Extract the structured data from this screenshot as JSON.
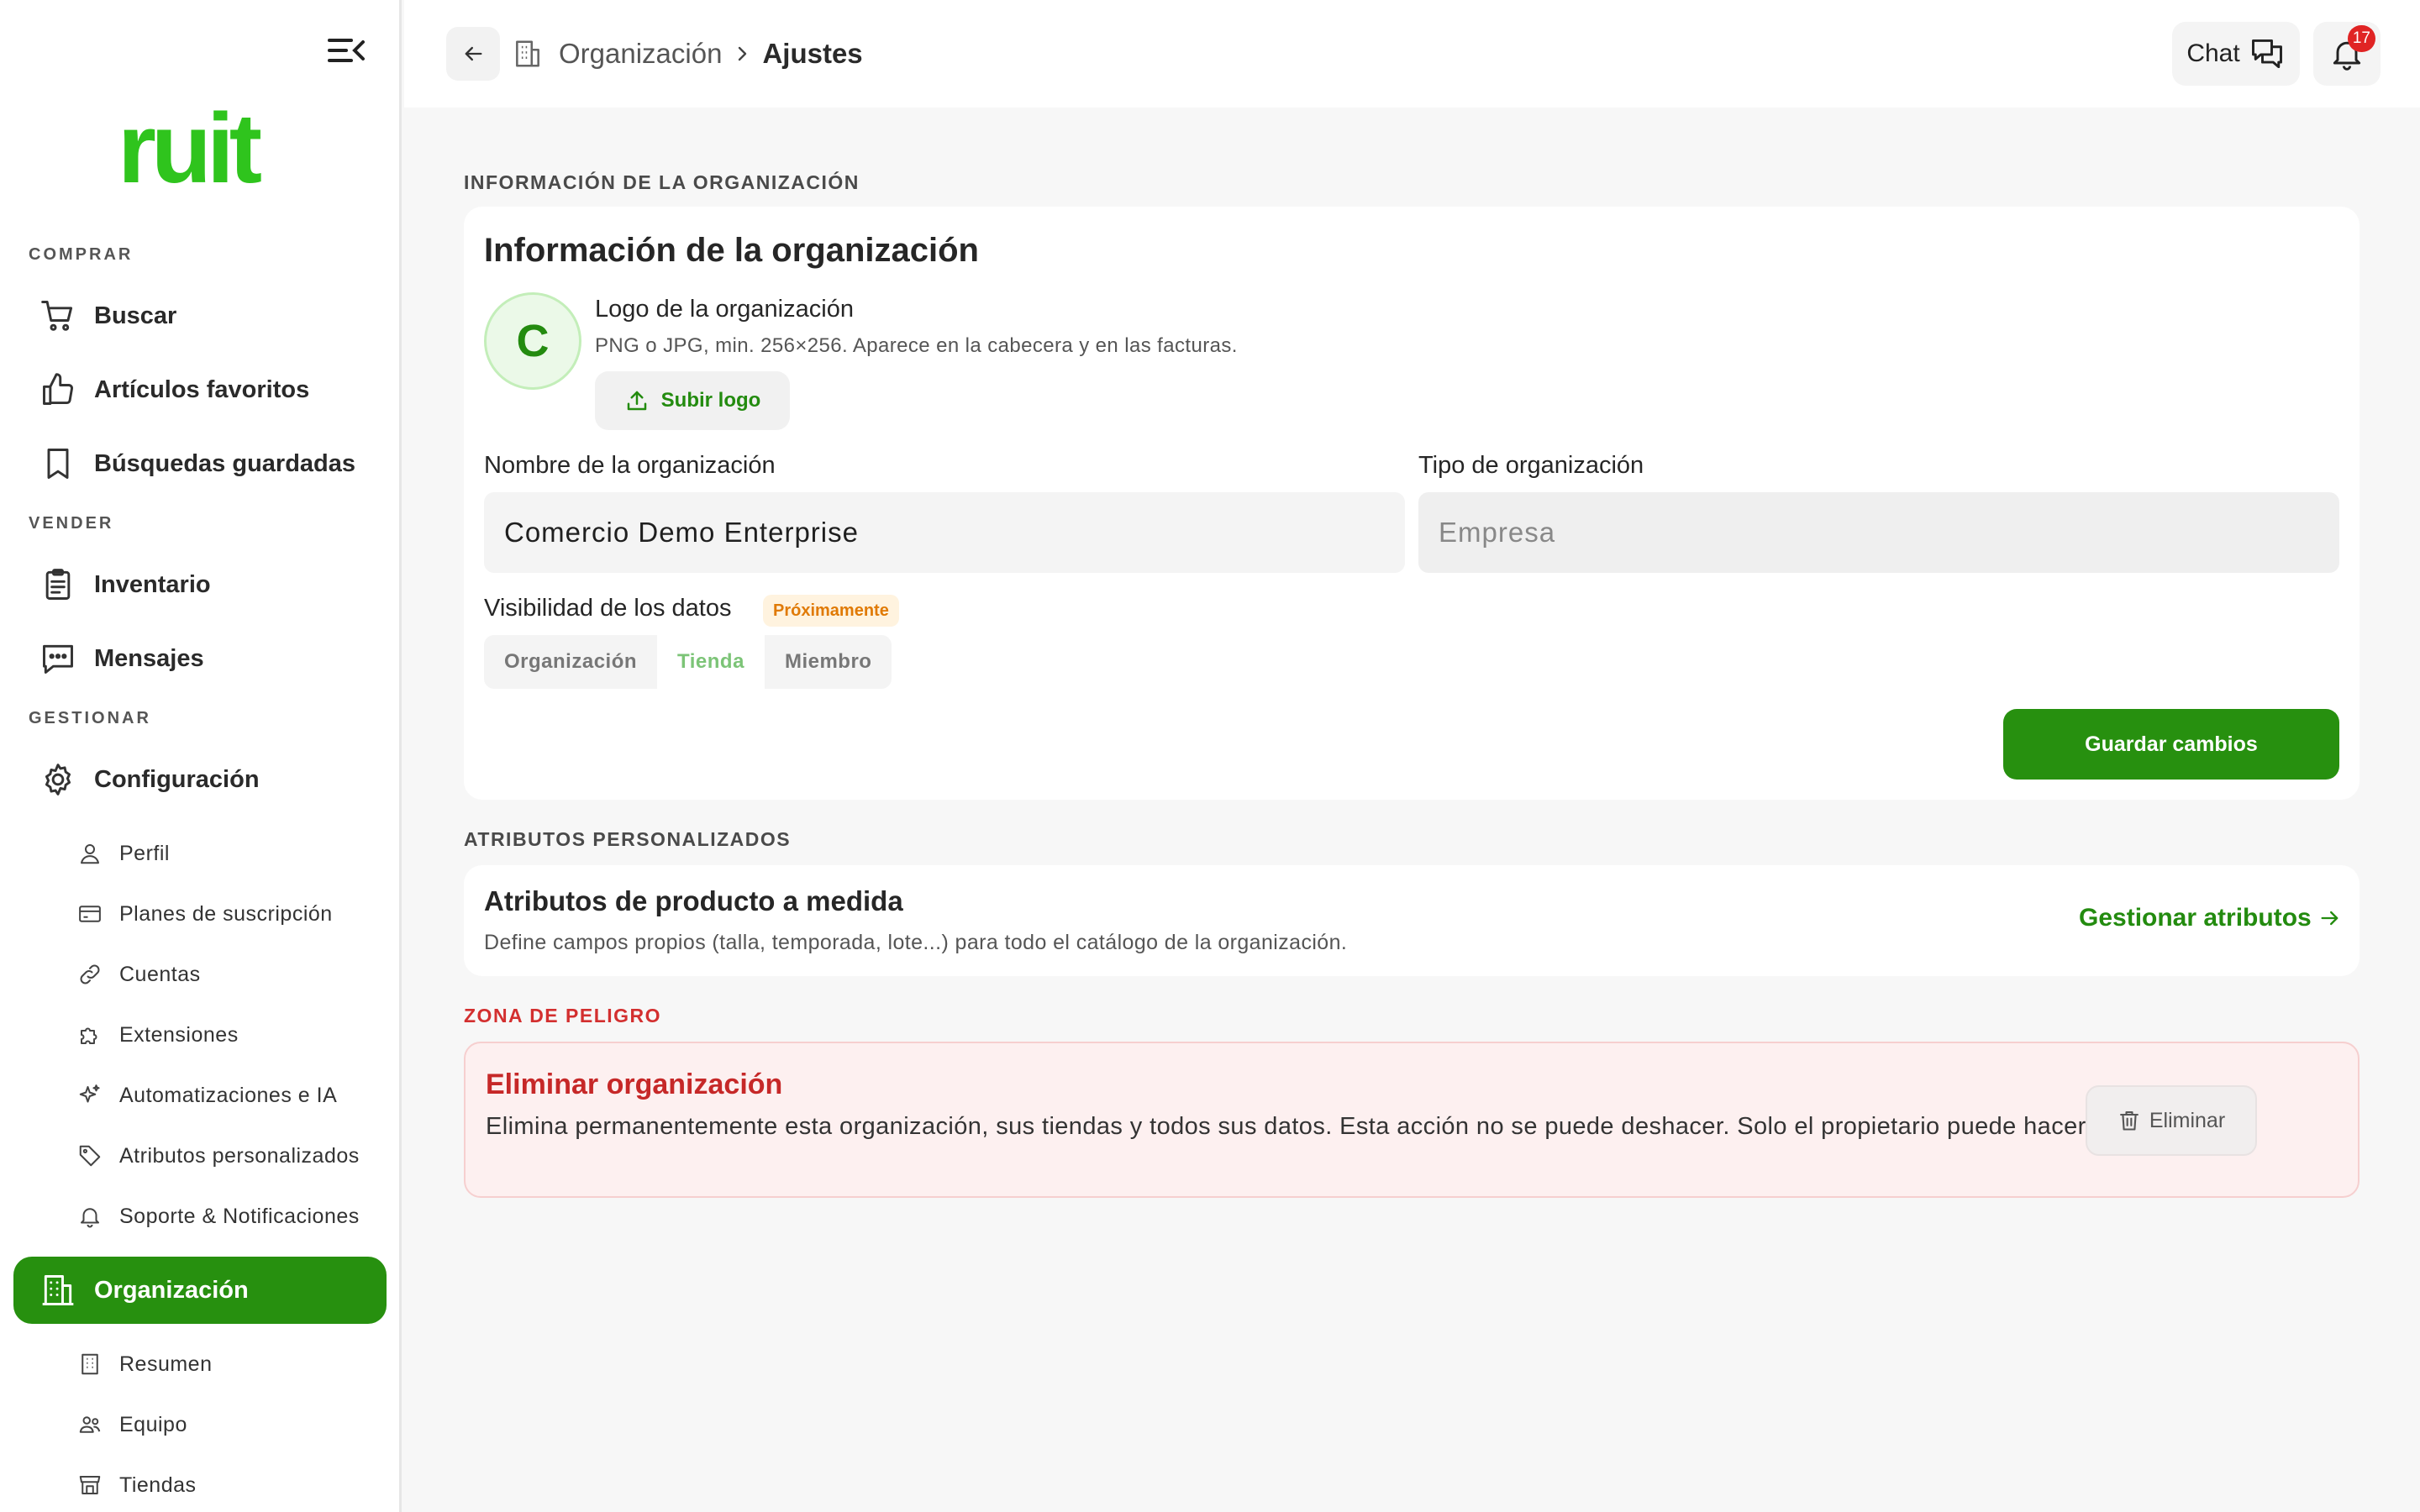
{
  "brand": {
    "logo_text": "ruit",
    "color": "#2fc41d"
  },
  "colors": {
    "accent": "#27900f",
    "danger": "#d32f2f",
    "badge": "#e02424",
    "soon": "#e07a05"
  },
  "sidebar": {
    "sections": {
      "buy": "COMPRAR",
      "sell": "VENDER",
      "manage": "GESTIONAR"
    },
    "items": [
      {
        "label": "Buscar",
        "icon": "cart-icon"
      },
      {
        "label": "Artículos favoritos",
        "icon": "thumbs-up-icon"
      },
      {
        "label": "Búsquedas guardadas",
        "icon": "bookmark-icon"
      },
      {
        "label": "Inventario",
        "icon": "clipboard-icon"
      },
      {
        "label": "Mensajes",
        "icon": "message-icon"
      },
      {
        "label": "Configuración",
        "icon": "gear-icon"
      },
      {
        "label": "Organización",
        "icon": "building-icon",
        "active": true
      }
    ],
    "config_subitems": [
      {
        "label": "Perfil",
        "icon": "user-icon"
      },
      {
        "label": "Planes de suscripción",
        "icon": "credit-card-icon"
      },
      {
        "label": "Cuentas",
        "icon": "link-icon"
      },
      {
        "label": "Extensiones",
        "icon": "puzzle-icon"
      },
      {
        "label": "Automatizaciones e IA",
        "icon": "sparkles-icon"
      },
      {
        "label": "Atributos personalizados",
        "icon": "tag-icon"
      },
      {
        "label": "Soporte & Notificaciones",
        "icon": "bell-icon"
      }
    ],
    "org_subitems": [
      {
        "label": "Resumen",
        "icon": "building-small-icon"
      },
      {
        "label": "Equipo",
        "icon": "team-icon"
      },
      {
        "label": "Tiendas",
        "icon": "store-icon"
      }
    ]
  },
  "topbar": {
    "breadcrumb_parent": "Organización",
    "breadcrumb_current": "Ajustes",
    "chat_label": "Chat",
    "notification_count": "17"
  },
  "org_info": {
    "section_label": "INFORMACIÓN DE LA ORGANIZACIÓN",
    "title": "Información de la organización",
    "avatar_letter": "C",
    "logo_title": "Logo de la organización",
    "logo_hint": "PNG o JPG, min. 256×256. Aparece en la cabecera y en las facturas.",
    "upload_label": "Subir logo",
    "name_label": "Nombre de la organización",
    "name_value": "Comercio Demo Enterprise",
    "type_label": "Tipo de organización",
    "type_value": "Empresa",
    "visibility_label": "Visibilidad de los datos",
    "soon_badge": "Próximamente",
    "visibility_options": [
      "Organización",
      "Tienda",
      "Miembro"
    ],
    "visibility_selected": "Tienda",
    "save_label": "Guardar cambios"
  },
  "custom_attrs": {
    "section_label": "ATRIBUTOS PERSONALIZADOS",
    "title": "Atributos de producto a medida",
    "description": "Define campos propios (talla, temporada, lote...) para todo el catálogo de la organización.",
    "link_label": "Gestionar atributos"
  },
  "danger_zone": {
    "section_label": "ZONA DE PELIGRO",
    "title": "Eliminar organización",
    "description": "Elimina permanentemente esta organización, sus tiendas y todos sus datos. Esta acción no se puede deshacer. Solo el propietario puede hacerlo.",
    "delete_label": "Eliminar"
  }
}
